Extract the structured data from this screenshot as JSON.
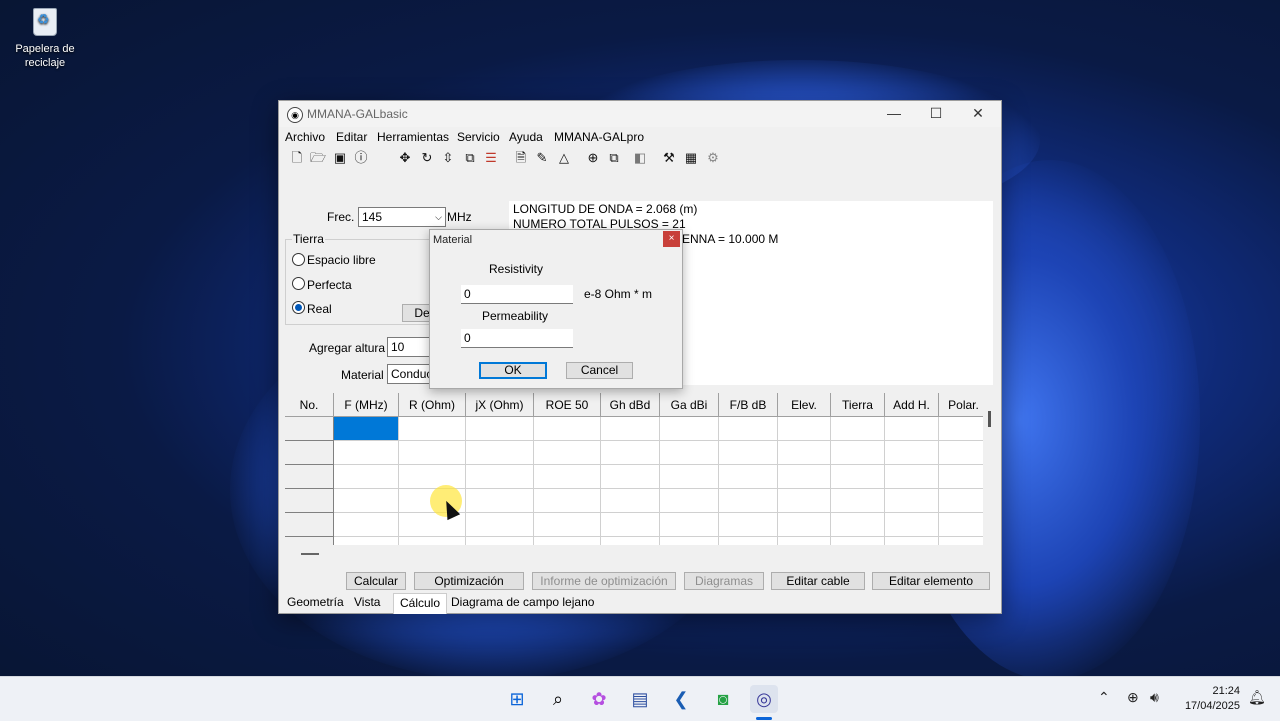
{
  "desktop": {
    "recycle_bin_label": "Papelera de reciclaje"
  },
  "window": {
    "title": "MMANA-GALbasic",
    "minimize": "—",
    "maximize": "☐",
    "close": "✕",
    "menu": [
      "Archivo",
      "Editar",
      "Herramientas",
      "Servicio",
      "Ayuda",
      "MMANA-GALpro"
    ],
    "toolbar_icons": [
      "new-file-icon",
      "open-folder-icon",
      "save-icon",
      "info-icon",
      "move-icon",
      "rotate-icon",
      "stretch-icon",
      "copy-icon",
      "align-icon",
      "page-icon",
      "pen-icon",
      "triangle-icon",
      "target-icon",
      "duplicate-icon",
      "layers-icon",
      "tools-icon",
      "calculator-icon",
      "gear-icon"
    ]
  },
  "calc_panel": {
    "freq_label": "Frec.",
    "freq_value": "145",
    "freq_unit": "MHz",
    "ground_group": "Tierra",
    "ground_options": [
      "Espacio libre",
      "Perfecta",
      "Real"
    ],
    "ground_selected": "Real",
    "de_button": "De",
    "height_label": "Agregar altura",
    "height_value": "10",
    "material_label": "Material",
    "material_value": "Conduc"
  },
  "info": {
    "line1": "LONGITUD DE ONDA = 2.068 (m)",
    "line2": "NUMERO TOTAL PULSOS = 21",
    "line3": "ENNA = 10.000 M"
  },
  "table": {
    "columns": [
      "No.",
      "F (MHz)",
      "R (Ohm)",
      "jX (Ohm)",
      "ROE 50",
      "Gh dBd",
      "Ga dBi",
      "F/B dB",
      "Elev.",
      "Tierra",
      "Add H.",
      "Polar."
    ],
    "rows": 5
  },
  "buttons": {
    "calcular": "Calcular",
    "optimizacion": "Optimización",
    "informe": "Informe de optimización",
    "diagramas": "Diagramas",
    "editar_cable": "Editar cable",
    "editar_elemento": "Editar elemento"
  },
  "tabs": [
    "Geometría",
    "Vista",
    "Cálculo",
    "Diagrama de campo lejano"
  ],
  "active_tab": "Cálculo",
  "dialog": {
    "title": "Material",
    "close": "×",
    "resistivity_label": "Resistivity",
    "resistivity_value": "0",
    "resistivity_unit": "e-8 Ohm * m",
    "permeability_label": "Permeability",
    "permeability_value": "0",
    "ok": "OK",
    "cancel": "Cancel"
  },
  "taskbar": {
    "icons": [
      "windows-start-icon",
      "search-icon",
      "copilot-icon",
      "app-icon",
      "kodi-icon",
      "whatsapp-icon",
      "mmana-icon"
    ],
    "time": "21:24",
    "date": "17/04/2025"
  }
}
